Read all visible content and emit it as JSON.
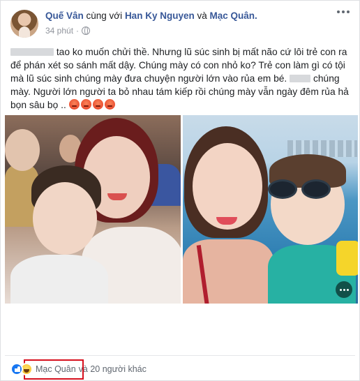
{
  "post": {
    "author": "Quế Vân",
    "with_word": "cùng với",
    "tagged_1": "Han Ky Nguyen",
    "and_word": "và",
    "tagged_2": "Mạc Quân.",
    "time": "34 phút",
    "privacy": "globe-icon",
    "text_1": "tao ko muốn chửi thề. Nhưng lũ súc sinh bị mất não cứ lôi trẻ con ra để phán xét so sánh mất dậy. Chúng mày có con nhỏ ko? Trẻ con làm gì có tội mà lũ súc sinh chúng mày đưa chuyện người lớn vào rủa em bé.",
    "text_2": "chúng mày. Người lớn người ta bỏ nhau tám kiếp rồi chúng mày vẫn ngày đêm rủa hả bọn sâu bọ ..",
    "emoji_count": 4
  },
  "reactions": {
    "first_name": "Mạc Quân",
    "rest": "và 20 người khác",
    "icons": [
      "like-icon",
      "haha-icon"
    ]
  },
  "colors": {
    "link": "#385898",
    "highlight": "#d60f1d",
    "like": "#1877f2"
  }
}
